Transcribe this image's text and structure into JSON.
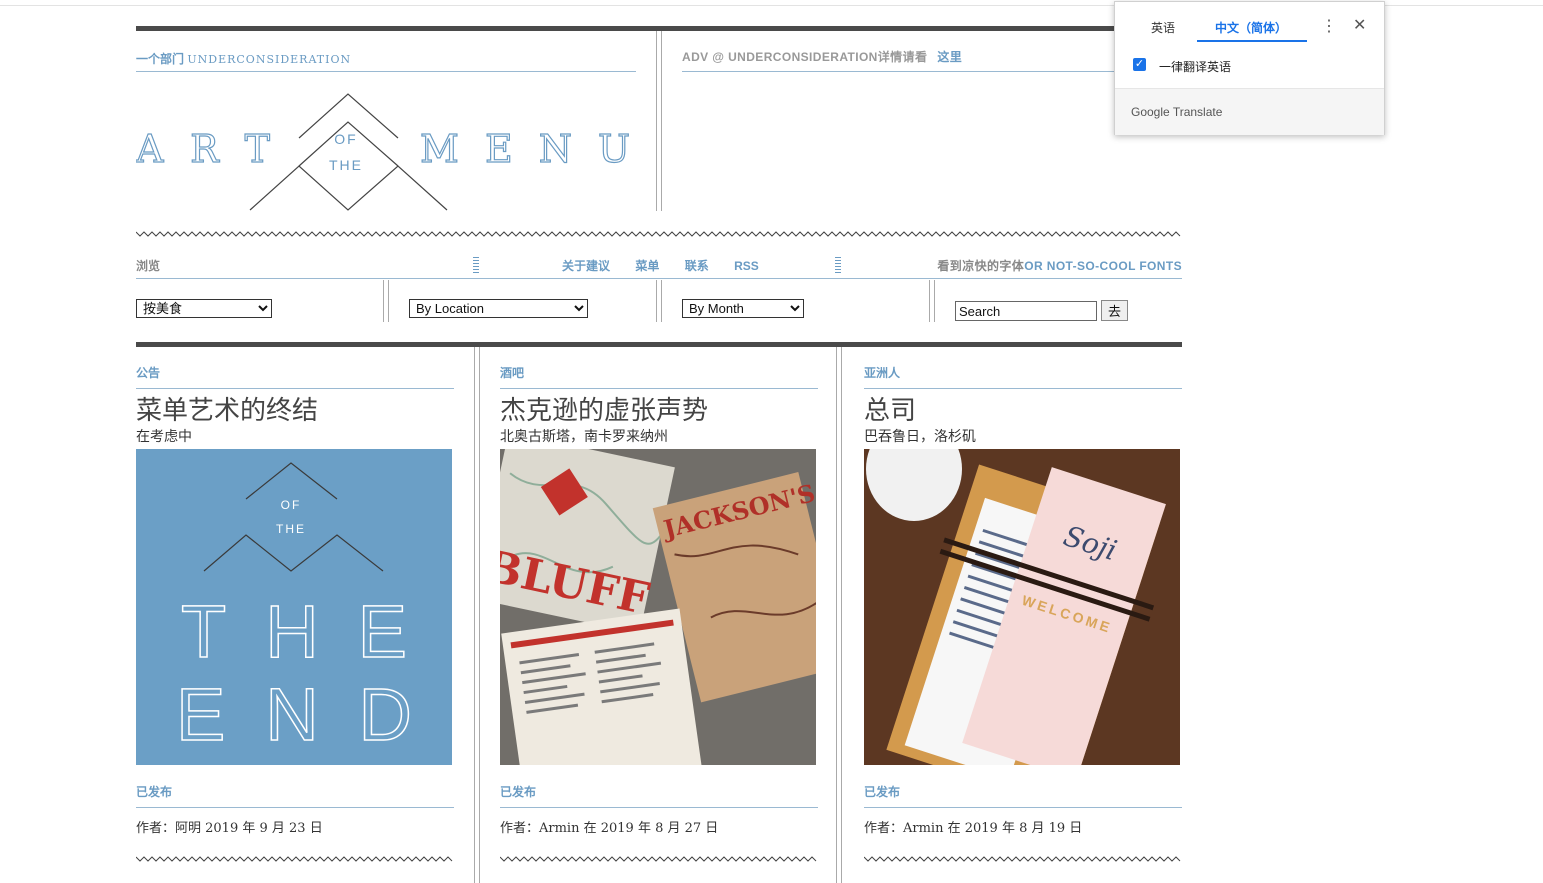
{
  "header": {
    "dept_prefix": "一个部门",
    "dept_brand": "UNDERCONSIDERATION",
    "logo_left": "ART",
    "logo_of": "OF",
    "logo_the": "THE",
    "logo_right": "MENU",
    "adv_text": "ADV @ UNDERCONSIDERATION详情请看",
    "adv_link": "这里"
  },
  "nav": {
    "browse_label": "浏览",
    "links": [
      "关于建议",
      "菜单",
      "联系",
      "RSS"
    ],
    "fonts_prefix": "看到凉快的字体",
    "fonts_suffix": "OR NOT-SO-COOL FONTS",
    "select_cuisine": "按美食",
    "select_location": "By Location",
    "select_month": "By Month",
    "search_value": "Search",
    "go_label": "去"
  },
  "posts": [
    {
      "category": "公告",
      "title": "菜单艺术的终结",
      "subtitle": "在考虑中",
      "thumb_of": "OF",
      "thumb_the": "THE",
      "thumb_big1": "THE",
      "thumb_big2": "END",
      "published_label": "已发布",
      "byline": "作者：阿明 2019 年 9 月 23 日"
    },
    {
      "category": "酒吧",
      "title": "杰克逊的虚张声势",
      "subtitle": "北奥古斯塔，南卡罗来纳州",
      "thumb_text1": "BLUFF",
      "thumb_text2": "JACKSON'S",
      "published_label": "已发布",
      "byline": "作者：Armin 在 2019 年 8 月 27 日"
    },
    {
      "category": "亚洲人",
      "title": "总司",
      "subtitle": "巴吞鲁日，洛杉矶",
      "thumb_text1": "Soji",
      "thumb_text2": "WELCOME",
      "published_label": "已发布",
      "byline": "作者：Armin 在 2019 年 8 月 19 日"
    }
  ],
  "translate": {
    "tab_source": "英语",
    "tab_target": "中文（简体）",
    "always_label": "一律翻译英语",
    "brand_google": "Google",
    "brand_translate": "Translate",
    "more_icon": "⋮",
    "close_icon": "✕"
  },
  "colors": {
    "accent": "#6a9bc3",
    "thumb_blue": "#6b9fc6",
    "bar": "#4a4a4a"
  }
}
